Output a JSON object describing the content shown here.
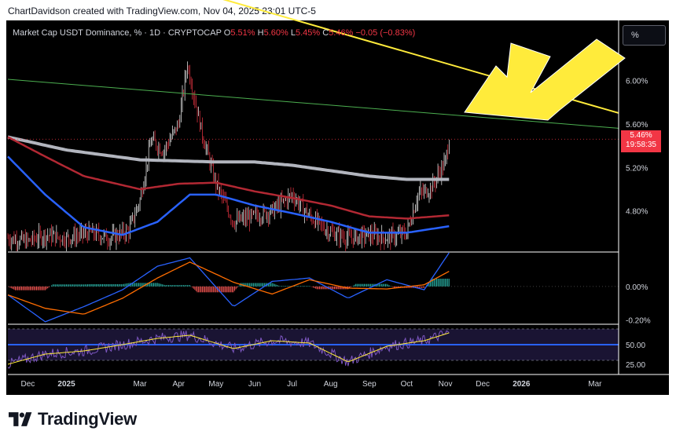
{
  "header": {
    "credit": "ChartDavidson created with TradingView.com, Nov 04, 2025 23:01 UTC-5"
  },
  "legend": {
    "symbol": "Market Cap USDT Dominance, % · 1D · CRYPTOCAP",
    "o_label": "O",
    "o_value": "5.51%",
    "h_label": "H",
    "h_value": "5.60%",
    "l_label": "L",
    "l_value": "5.45%",
    "c_label": "C",
    "c_value": "5.46%",
    "change": "−0.05 (−0.83%)"
  },
  "controls": {
    "scale_button": "%"
  },
  "price_badge": {
    "price": "5.46%",
    "countdown": "19:58:35"
  },
  "brand": {
    "logo_text": "TradingView"
  },
  "colors": {
    "background": "#000000",
    "up_candle": "#ffffff",
    "down_candle": "#f23645",
    "ma_gray": "#b2b5be",
    "ma_red": "#b22833",
    "ma_blue": "#2962ff",
    "arrow": "#ffeb3b",
    "rsi_level": "#2962ff"
  },
  "chart_data": {
    "type": "line",
    "title": "Market Cap USDT Dominance, % · 1D · CRYPTOCAP",
    "price_axis": {
      "ticks": [
        "6.00%",
        "5.60%",
        "5.20%",
        "4.80%"
      ],
      "values": [
        6.0,
        5.6,
        5.2,
        4.8
      ],
      "ylim": [
        4.43,
        6.45
      ],
      "scale": "linear"
    },
    "macd_axis": {
      "ticks": [
        "0.00%",
        "-0.20%"
      ],
      "values": [
        0.0,
        -0.2
      ],
      "ylim": [
        -0.22,
        0.2
      ]
    },
    "rsi_axis": {
      "ticks": [
        "50.00",
        "25.00"
      ],
      "values": [
        50,
        25
      ]
    },
    "x_ticks": [
      "Dec",
      "2025",
      "Mar",
      "Apr",
      "May",
      "Jun",
      "Jul",
      "Aug",
      "Sep",
      "Oct",
      "Nov",
      "Dec",
      "2026",
      "Mar"
    ],
    "x_dates": [
      "2024-12-01",
      "2025-01-01",
      "2025-03-01",
      "2025-04-01",
      "2025-05-01",
      "2025-06-01",
      "2025-07-01",
      "2025-08-01",
      "2025-09-01",
      "2025-10-01",
      "2025-11-01",
      "2025-12-01",
      "2026-01-01",
      "2026-03-01"
    ],
    "xlim": [
      "2024-11-15",
      "2026-03-20"
    ],
    "series": [
      {
        "name": "",
        "role": "close",
        "x": [
          "2024-11-15",
          "2024-12-01",
          "2024-12-15",
          "2025-01-01",
          "2025-01-20",
          "2025-02-05",
          "2025-02-20",
          "2025-03-01",
          "2025-03-10",
          "2025-03-20",
          "2025-04-01",
          "2025-04-08",
          "2025-04-20",
          "2025-05-01",
          "2025-05-15",
          "2025-06-01",
          "2025-06-15",
          "2025-07-01",
          "2025-07-15",
          "2025-08-01",
          "2025-08-15",
          "2025-09-01",
          "2025-09-15",
          "2025-10-01",
          "2025-10-10",
          "2025-10-20",
          "2025-11-01",
          "2025-11-04"
        ],
        "values": [
          4.55,
          4.52,
          4.58,
          4.55,
          4.6,
          4.55,
          4.62,
          4.9,
          5.45,
          5.35,
          5.6,
          6.15,
          5.5,
          5.05,
          4.7,
          4.75,
          4.8,
          4.95,
          4.75,
          4.6,
          4.55,
          4.58,
          4.55,
          4.6,
          4.95,
          5.0,
          5.25,
          5.46
        ]
      },
      {
        "name": "",
        "role": "ma_gray",
        "x": [
          "2024-11-15",
          "2025-01-01",
          "2025-03-01",
          "2025-04-01",
          "2025-05-01",
          "2025-06-01",
          "2025-07-01",
          "2025-08-01",
          "2025-09-01",
          "2025-10-01",
          "2025-11-04"
        ],
        "values": [
          5.48,
          5.36,
          5.27,
          5.26,
          5.25,
          5.25,
          5.22,
          5.17,
          5.12,
          5.09,
          5.09
        ]
      },
      {
        "name": "",
        "role": "ma_red",
        "x": [
          "2024-11-15",
          "2024-12-15",
          "2025-01-15",
          "2025-03-01",
          "2025-04-01",
          "2025-05-01",
          "2025-06-01",
          "2025-07-01",
          "2025-08-01",
          "2025-09-01",
          "2025-10-01",
          "2025-11-04"
        ],
        "values": [
          5.48,
          5.3,
          5.12,
          5.0,
          5.05,
          5.06,
          4.98,
          4.92,
          4.85,
          4.75,
          4.73,
          4.76
        ]
      },
      {
        "name": "",
        "role": "ma_blue",
        "x": [
          "2024-11-15",
          "2024-12-15",
          "2025-01-15",
          "2025-02-15",
          "2025-03-15",
          "2025-04-10",
          "2025-05-01",
          "2025-06-01",
          "2025-07-01",
          "2025-08-01",
          "2025-09-01",
          "2025-10-01",
          "2025-11-04"
        ],
        "values": [
          5.3,
          4.95,
          4.65,
          4.58,
          4.7,
          4.95,
          4.95,
          4.85,
          4.78,
          4.7,
          4.6,
          4.6,
          4.66
        ]
      },
      {
        "name": "",
        "role": "trendline_green",
        "x": [
          "2024-11-15",
          "2026-03-20"
        ],
        "values": [
          6.01,
          5.56
        ]
      },
      {
        "name": "",
        "role": "trendline_yellow",
        "x": [
          "2025-04-20",
          "2026-03-20"
        ],
        "values": [
          6.8,
          5.7
        ]
      },
      {
        "name": "",
        "role": "macd",
        "x": [
          "2024-11-15",
          "2024-12-15",
          "2025-01-15",
          "2025-02-15",
          "2025-03-15",
          "2025-04-10",
          "2025-05-15",
          "2025-06-15",
          "2025-07-15",
          "2025-08-15",
          "2025-09-15",
          "2025-10-15",
          "2025-11-04"
        ],
        "values": [
          -0.05,
          -0.21,
          -0.12,
          -0.02,
          0.12,
          0.17,
          -0.12,
          0.03,
          0.05,
          -0.07,
          0.04,
          -0.02,
          0.2
        ]
      },
      {
        "name": "",
        "role": "rsi",
        "x": [
          "2024-11-15",
          "2024-12-15",
          "2025-01-15",
          "2025-02-15",
          "2025-03-15",
          "2025-04-10",
          "2025-05-15",
          "2025-06-15",
          "2025-07-15",
          "2025-08-15",
          "2025-09-15",
          "2025-10-15",
          "2025-11-04"
        ],
        "values": [
          25,
          38,
          42,
          50,
          58,
          62,
          45,
          55,
          52,
          28,
          48,
          55,
          65
        ]
      }
    ],
    "rsi_level": 50,
    "grid": false
  }
}
